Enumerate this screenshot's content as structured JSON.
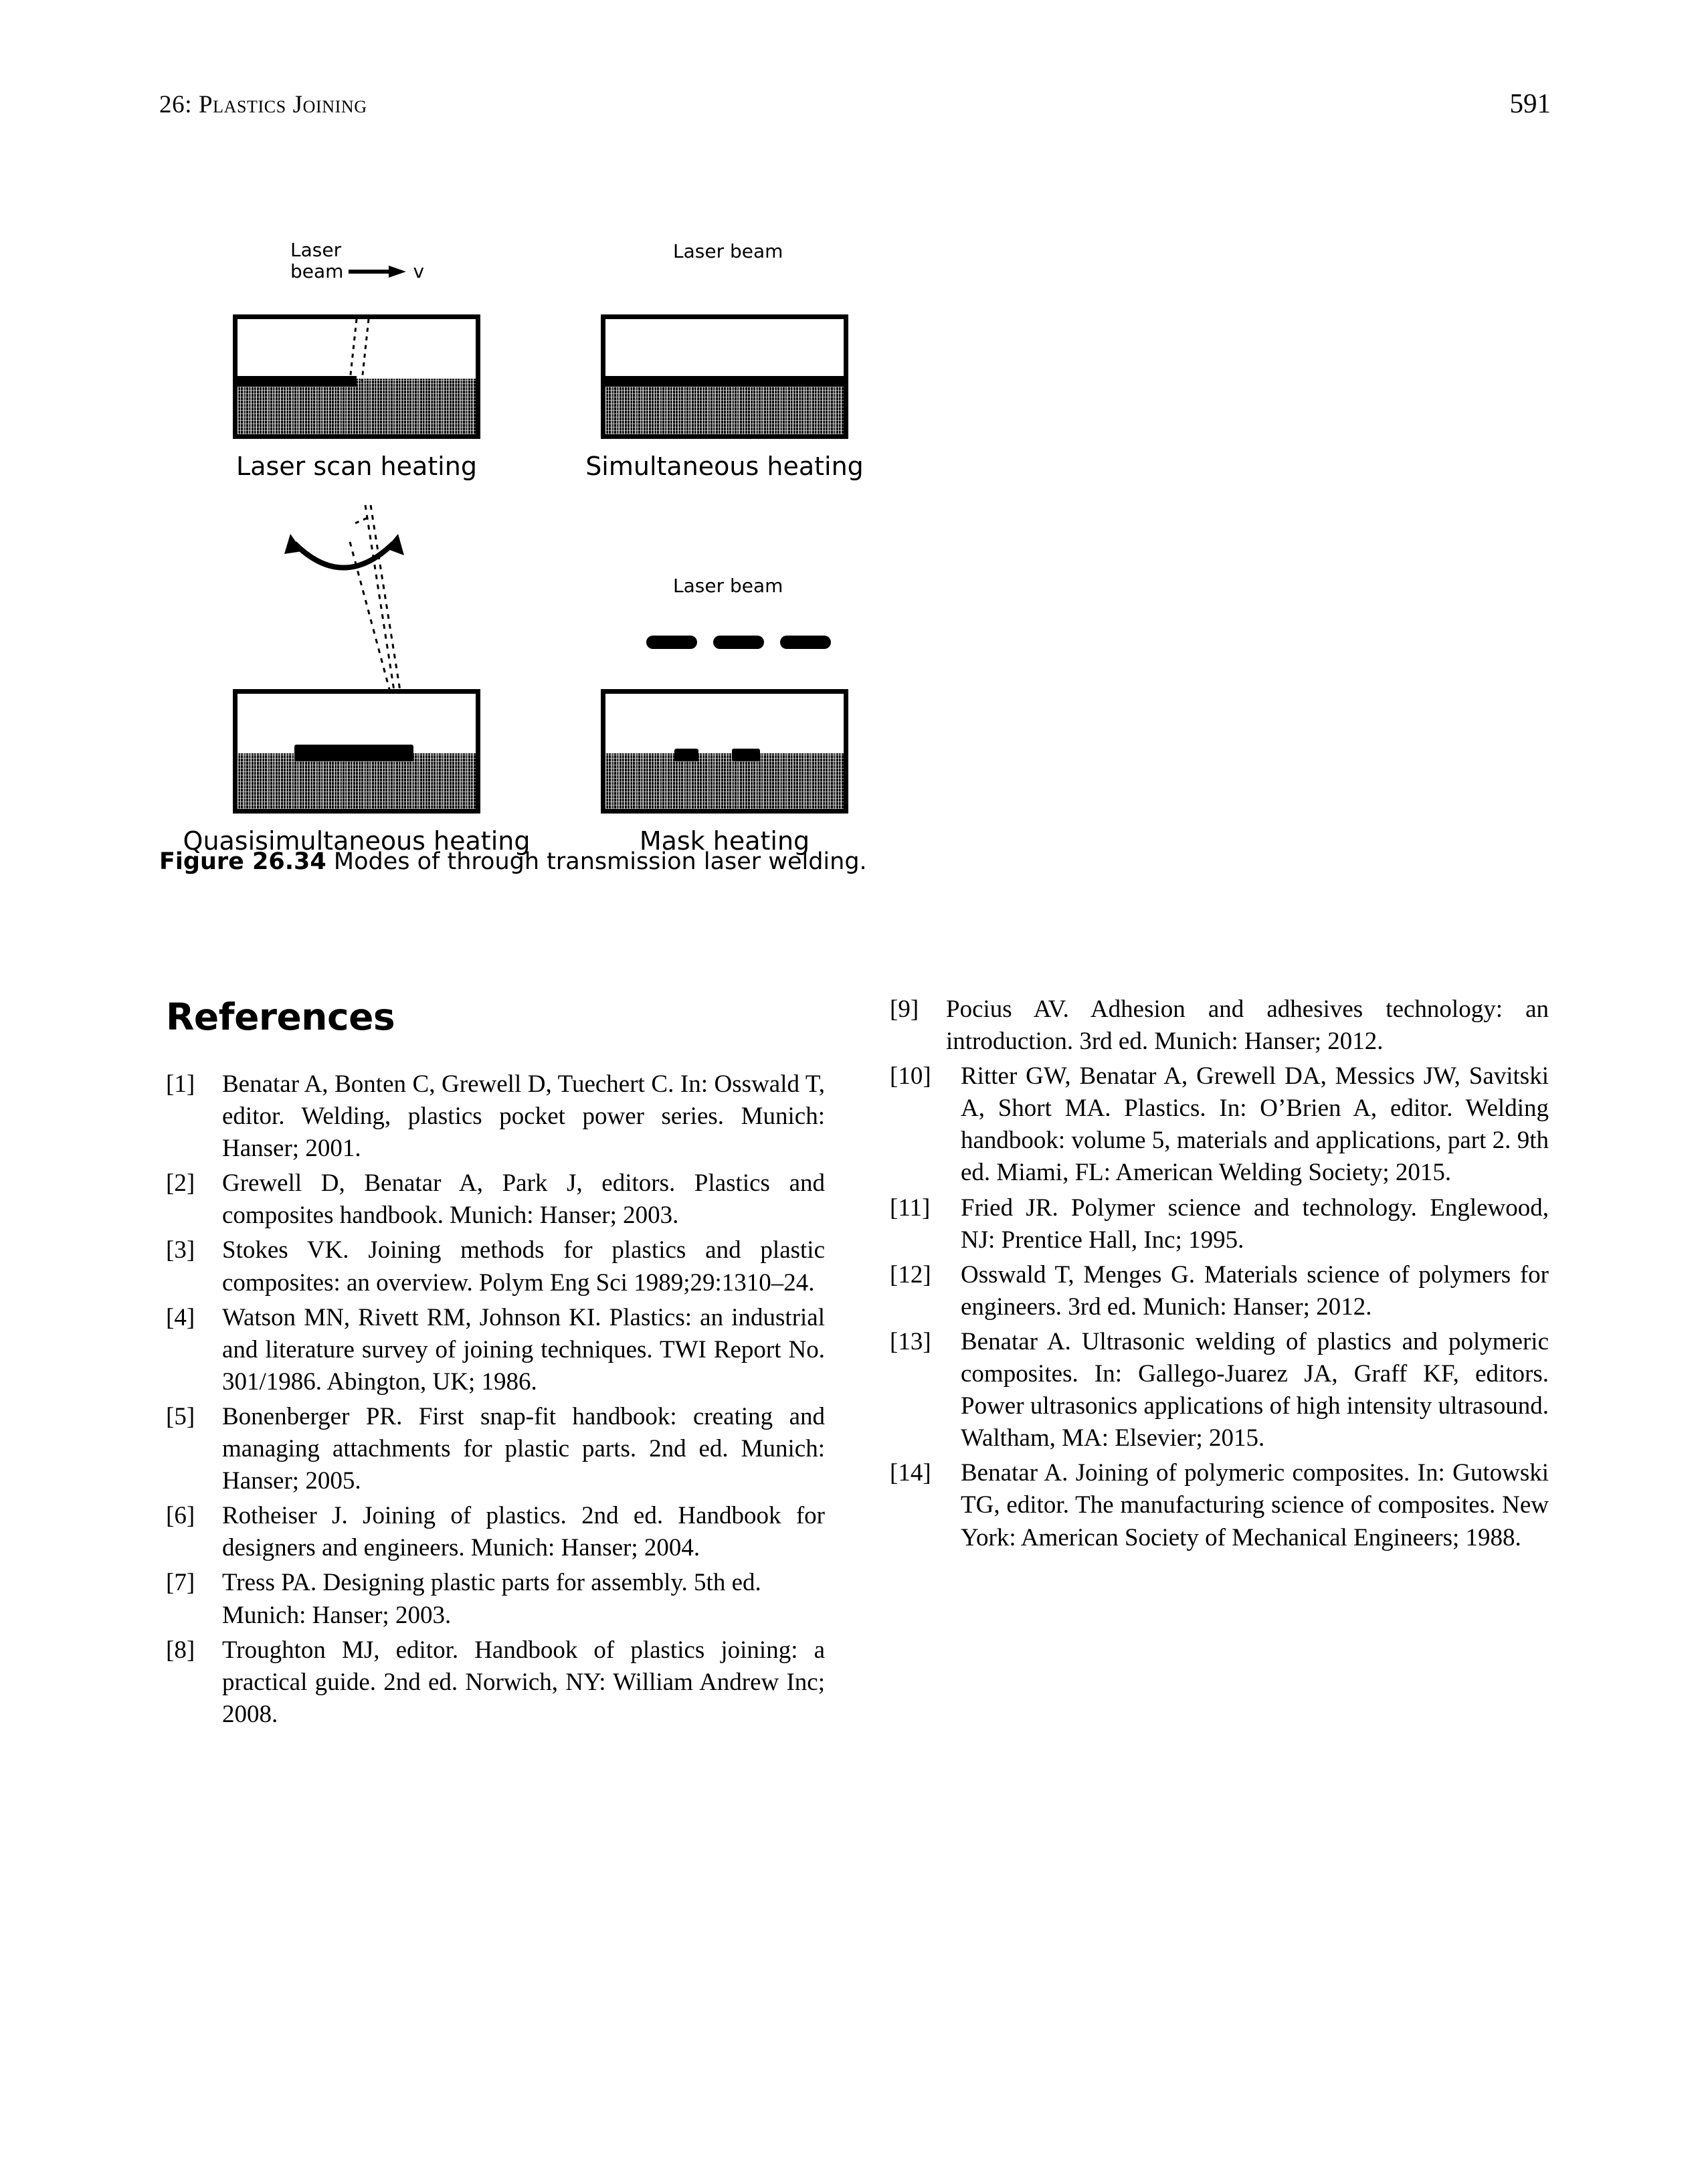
{
  "running_head": {
    "chapter_label": "26:",
    "chapter_title": "Plastics Joining",
    "page_number": "591"
  },
  "figure": {
    "caption_number": "Figure 26.34",
    "caption_text": "Modes of through transmission laser welding.",
    "panels": [
      {
        "id": "laser-scan-heating",
        "label": "Laser scan heating",
        "beam_label_line1": "Laser",
        "beam_label_line2": "beam",
        "velocity_symbol": "v",
        "arrow": "horizontal-arrow-right"
      },
      {
        "id": "simultaneous-heating",
        "label": "Simultaneous heating",
        "beam_label": "Laser beam"
      },
      {
        "id": "quasisimultaneous-heating",
        "label": "Quasisimultaneous heating",
        "arrow": "curved-double-headed-arrow",
        "beam": "dashed-scanning-beam"
      },
      {
        "id": "mask-heating",
        "label": "Mask heating",
        "beam_label": "Laser beam",
        "mask_bar_count": 3
      }
    ]
  },
  "references_section": {
    "heading": "References",
    "left_column": [
      {
        "num": "[1]",
        "text": "Benatar A, Bonten C, Grewell D, Tuechert C. In: Osswald T, editor. Welding, plastics pocket power series. Munich: Hanser; 2001."
      },
      {
        "num": "[2]",
        "text": "Grewell D, Benatar A, Park J, editors. Plastics and composites handbook. Munich: Hanser; 2003."
      },
      {
        "num": "[3]",
        "text": "Stokes VK. Joining methods for plastics and plastic composites: an overview. Polym Eng Sci 1989;29:1310–24."
      },
      {
        "num": "[4]",
        "text": "Watson MN, Rivett RM, Johnson KI. Plastics: an industrial and literature survey of joining techniques. TWI Report No. 301/1986. Abington, UK; 1986."
      },
      {
        "num": "[5]",
        "text": "Bonenberger PR. First snap-fit handbook: creating and managing attachments for plastic parts. 2nd ed. Munich: Hanser; 2005."
      },
      {
        "num": "[6]",
        "text": "Rotheiser J. Joining of plastics. 2nd ed. Handbook for designers and engineers. Munich: Hanser; 2004."
      },
      {
        "num": "[7]",
        "text": "Tress PA. Designing plastic parts for assembly. 5th ed. Munich: Hanser; 2003."
      },
      {
        "num": "[8]",
        "text": "Troughton MJ, editor. Handbook of plastics joining: a practical guide. 2nd ed. Norwich, NY: William Andrew Inc; 2008."
      }
    ],
    "right_column": [
      {
        "num": "[9]",
        "text": "Pocius AV. Adhesion and adhesives technology: an introduction. 3rd ed. Munich: Hanser; 2012."
      },
      {
        "num": "[10]",
        "text": "Ritter GW, Benatar A, Grewell DA, Messics JW, Savitski A, Short MA. Plastics. In: O’Brien A, editor. Welding handbook: volume 5, materials and applications, part 2. 9th ed. Miami, FL: American Welding Society; 2015."
      },
      {
        "num": "[11]",
        "text": "Fried JR. Polymer science and technology. Englewood, NJ: Prentice Hall, Inc; 1995."
      },
      {
        "num": "[12]",
        "text": "Osswald T, Menges G. Materials science of polymers for engineers. 3rd ed. Munich: Hanser; 2012."
      },
      {
        "num": "[13]",
        "text": "Benatar A. Ultrasonic welding of plastics and polymeric composites. In: Gallego-Juarez JA, Graff KF, editors. Power ultrasonics applications of high intensity ultrasound. Waltham, MA: Elsevier; 2015."
      },
      {
        "num": "[14]",
        "text": "Benatar A. Joining of polymeric composites. In: Gutowski TG, editor. The manufacturing science of composites. New York: American Society of Mechanical Engineers; 1988."
      }
    ]
  }
}
